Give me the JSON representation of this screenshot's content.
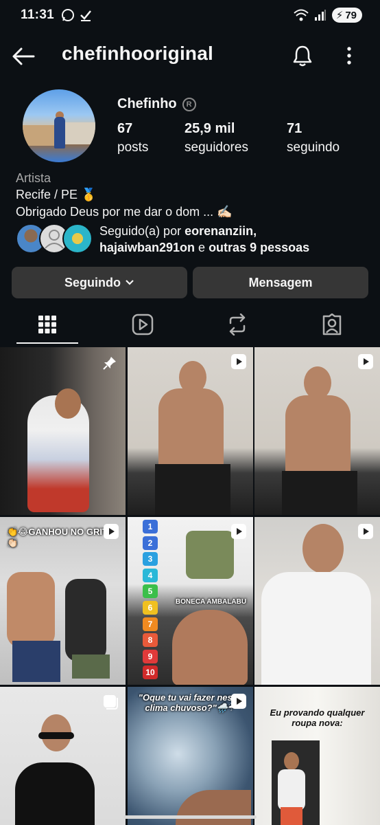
{
  "status_bar": {
    "time": "11:31",
    "battery": "79"
  },
  "header": {
    "username": "chefinhooriginal"
  },
  "profile": {
    "display_name": "Chefinho",
    "posts": {
      "count": "67",
      "label": "posts"
    },
    "followers": {
      "count": "25,9 mil",
      "label": "seguidores"
    },
    "following": {
      "count": "71",
      "label": "seguindo"
    },
    "category": "Artista",
    "bio_line1": "Recife / PE 🥇",
    "bio_line2": "Obrigado Deus por me dar o dom ... ✍🏻"
  },
  "followed_by": {
    "prefix": "Seguido(a) por ",
    "user1": "eorenanziin,",
    "user2": "hajaiwban291on",
    "middle": " e ",
    "others": "outras 9 pessoas"
  },
  "buttons": {
    "following": "Seguindo",
    "message": "Mensagem"
  },
  "tabs": [
    "grid-icon",
    "reels-icon",
    "reposts-icon",
    "tagged-icon"
  ],
  "grid": {
    "captions": {
      "post4": "👏😂GANHOU NO GRITO 👏🏻",
      "post5_label": "BONECA AMBALABU",
      "post8": "\"Oque tu vai fazer nesse clima chuvoso?\"🌧️☔",
      "post9": "Eu provando qualquer roupa nova:"
    },
    "numbers": [
      "1",
      "2",
      "3",
      "4",
      "5",
      "6",
      "7",
      "8",
      "9",
      "10"
    ]
  },
  "colors": {
    "background": "#0c1014",
    "button": "#363636",
    "muted": "#a8a8a8"
  }
}
